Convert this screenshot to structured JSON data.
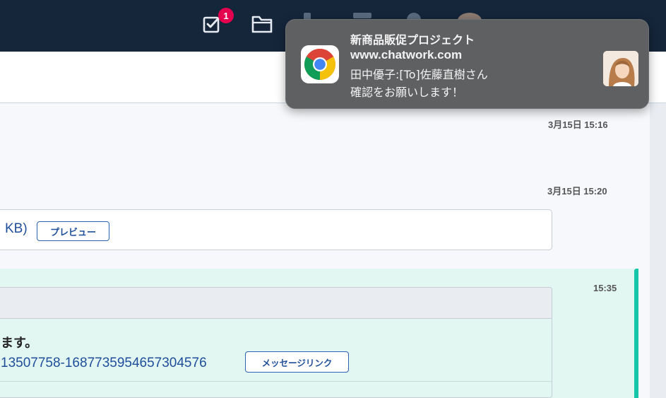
{
  "header": {
    "task_badge_count": "1",
    "icons": [
      "task-checkbox-icon",
      "folder-icon"
    ]
  },
  "timeline": {
    "timestamp_1": "3月15日 15:16",
    "timestamp_2": "3月15日 15:20",
    "timestamp_3": "15:35",
    "file_size_fragment": "KB)",
    "preview_button": "プレビュー",
    "quote_text_fragment": "ます。",
    "quote_link_fragment": "13507758-1687735954657304576",
    "message_link_button": "メッセージリンク"
  },
  "notification": {
    "title": "新商品販促プロジェクト",
    "source": "www.chatwork.com",
    "message_line1": "田中優子:[To]佐藤直樹さん",
    "message_line2": "確認をお願いします！",
    "app_icon": "chrome-icon"
  },
  "colors": {
    "header_bg": "#15253a",
    "badge": "#e5004f",
    "mention_bg": "#e2f6f2",
    "mention_accent": "#17c6a8",
    "link": "#1f4f9a"
  }
}
